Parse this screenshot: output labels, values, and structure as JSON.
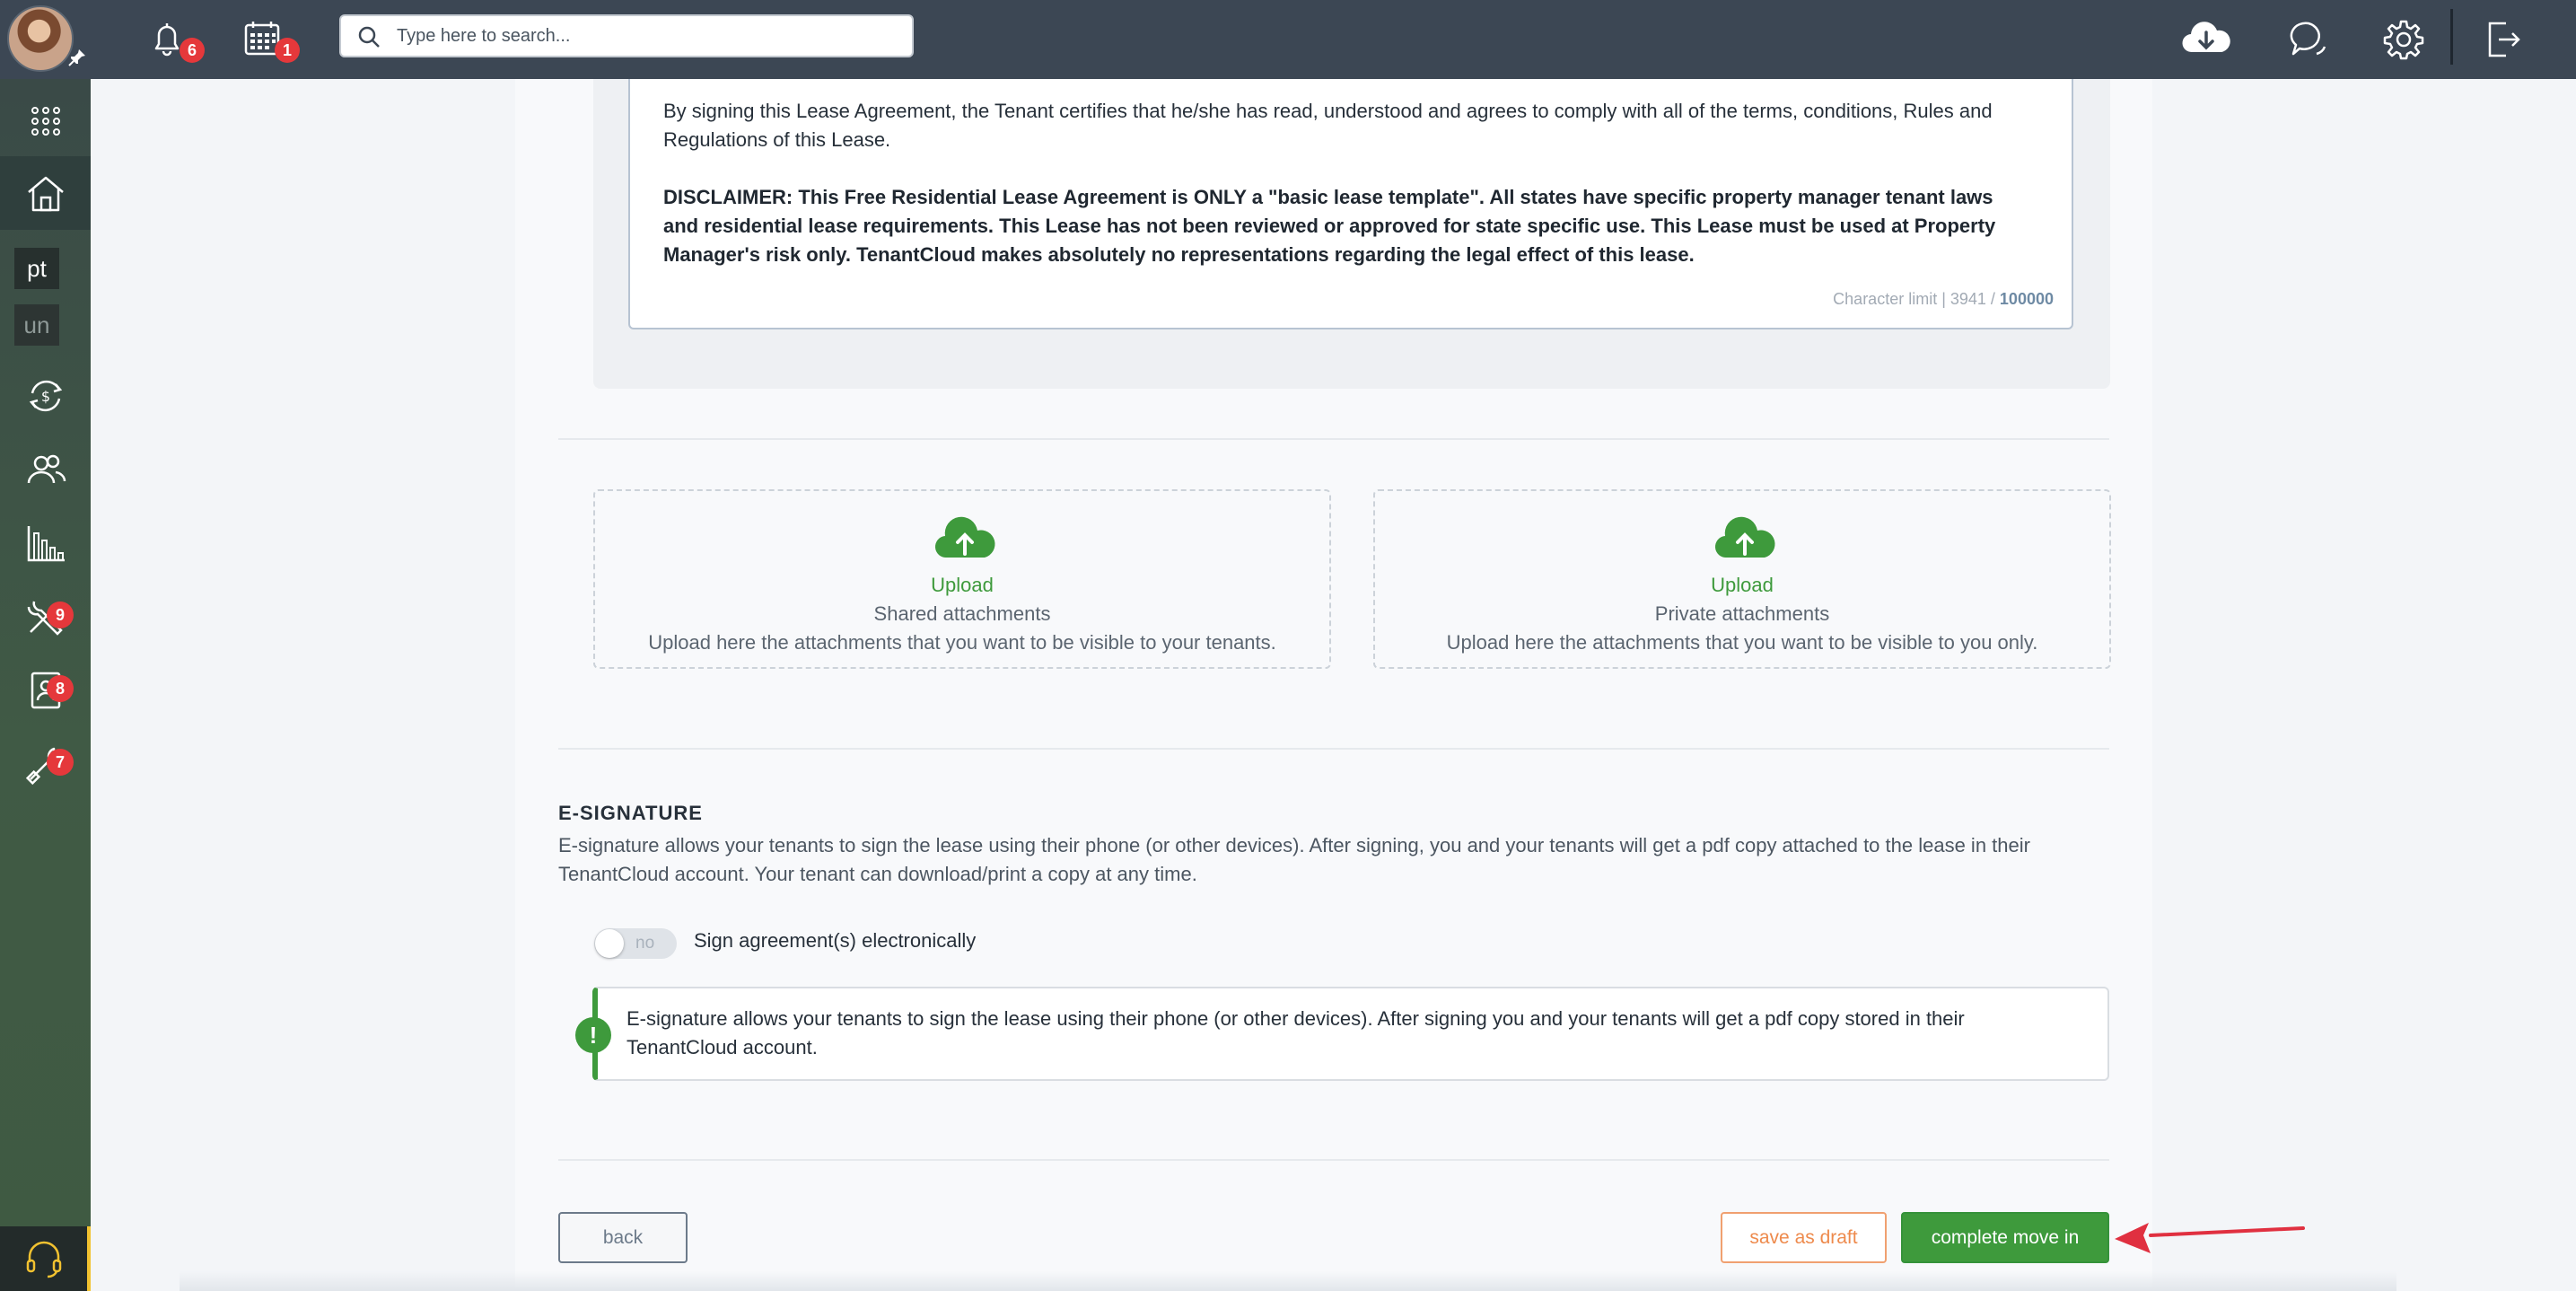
{
  "topbar": {
    "notifications_count": "6",
    "calendar_count": "1",
    "search_placeholder": "Type here to search..."
  },
  "sidebar": {
    "property_chip_1": "pt",
    "property_chip_2": "un",
    "maintenance_badge": "9",
    "applications_badge": "8",
    "tools_badge": "7"
  },
  "lease": {
    "certify_text": "By signing this Lease Agreement, the Tenant certifies that he/she has read, understood and agrees to comply with all of the terms, conditions, Rules and Regulations of this Lease.",
    "disclaimer_text": "DISCLAIMER: This Free Residential Lease Agreement is ONLY a \"basic lease template\". All states have specific property manager tenant laws and residential lease requirements. This Lease has not been reviewed or approved for state specific use. This Lease must be used at Property Manager's risk only. TenantCloud makes absolutely no representations regarding the legal effect of this lease.",
    "char_limit_label": "Character limit | 3941 / ",
    "char_limit_max": "100000"
  },
  "uploads": {
    "shared": {
      "title": "Upload",
      "subtitle": "Shared attachments",
      "description": "Upload here the attachments that you want to be visible to your tenants."
    },
    "private": {
      "title": "Upload",
      "subtitle": "Private attachments",
      "description": "Upload here the attachments that you want to be visible to you only."
    }
  },
  "esignature": {
    "heading": "E-SIGNATURE",
    "description": "E-signature allows your tenants to sign the lease using their phone (or other devices). After signing, you and your tenants will get a pdf copy attached to the lease in their TenantCloud account. Your tenant can download/print a copy at any time.",
    "toggle_state": "no",
    "toggle_label": "Sign agreement(s) electronically",
    "notice_icon": "!",
    "notice_text": "E-signature allows your tenants to sign the lease using their phone (or other devices). After signing you and your tenants will get a pdf copy stored in their TenantCloud account."
  },
  "actions": {
    "back": "back",
    "save_draft": "save as draft",
    "complete": "complete move in"
  },
  "colors": {
    "accent_green": "#3e9a3c",
    "draft_orange": "#ee8a4c",
    "badge_red": "#e5383b",
    "arrow_red": "#e03040"
  }
}
